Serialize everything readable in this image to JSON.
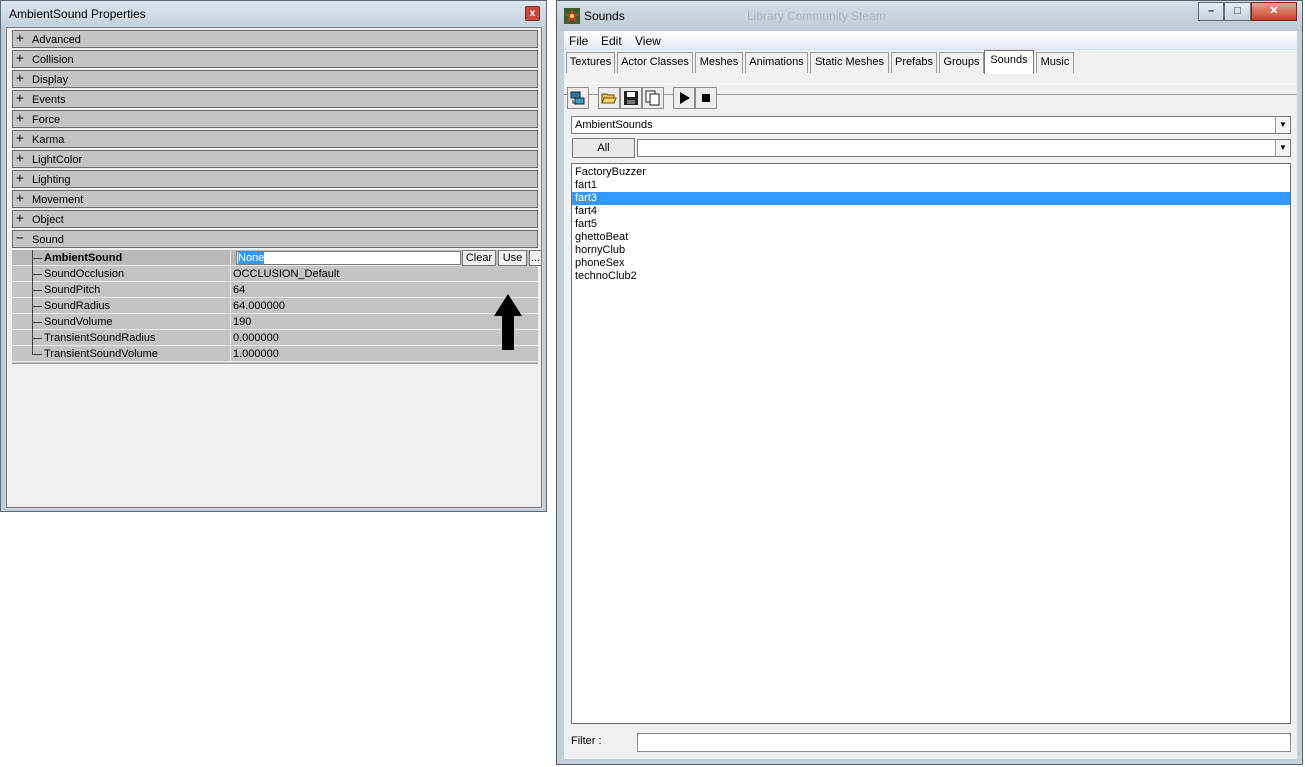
{
  "properties_window": {
    "title": "AmbientSound Properties",
    "close_glyph": "x",
    "categories": [
      {
        "label": "Advanced",
        "state": "+"
      },
      {
        "label": "Collision",
        "state": "+"
      },
      {
        "label": "Display",
        "state": "+"
      },
      {
        "label": "Events",
        "state": "+"
      },
      {
        "label": "Force",
        "state": "+"
      },
      {
        "label": "Karma",
        "state": "+"
      },
      {
        "label": "LightColor",
        "state": "+"
      },
      {
        "label": "Lighting",
        "state": "+"
      },
      {
        "label": "Movement",
        "state": "+"
      },
      {
        "label": "Object",
        "state": "+"
      },
      {
        "label": "Sound",
        "state": "−"
      }
    ],
    "sound_properties": [
      {
        "name": "AmbientSound",
        "value": "None"
      },
      {
        "name": "SoundOcclusion",
        "value": "OCCLUSION_Default"
      },
      {
        "name": "SoundPitch",
        "value": "64"
      },
      {
        "name": "SoundRadius",
        "value": "64.000000"
      },
      {
        "name": "SoundVolume",
        "value": "190"
      },
      {
        "name": "TransientSoundRadius",
        "value": "0.000000"
      },
      {
        "name": "TransientSoundVolume",
        "value": "1.000000"
      }
    ],
    "buttons": {
      "clear": "Clear",
      "use": "Use",
      "browse": "..."
    }
  },
  "sounds_window": {
    "title": "Sounds",
    "background_title": "Library  Community  Steam",
    "caption_buttons": {
      "minimize": "–",
      "maximize": "□",
      "close": "✕"
    },
    "menu": [
      "File",
      "Edit",
      "View"
    ],
    "tabs": [
      "Textures",
      "Actor Classes",
      "Meshes",
      "Animations",
      "Static Meshes",
      "Prefabs",
      "Groups",
      "Sounds",
      "Music"
    ],
    "active_tab": "Sounds",
    "toolbar_icons": [
      "import-icon",
      "open-icon",
      "save-icon",
      "copy-icon",
      "play-icon",
      "stop-icon"
    ],
    "package": "AmbientSounds",
    "all_button": "All",
    "group": "",
    "sounds": [
      "FactoryBuzzer",
      "fart1",
      "fart3",
      "fart4",
      "fart5",
      "ghettoBeat",
      "hornyClub",
      "phoneSex",
      "technoClub2"
    ],
    "selected_sound": "fart3",
    "filter_label": "Filter :",
    "filter_value": ""
  },
  "colors": {
    "selection": "#3399ff",
    "category_bg": "#c4c4c4",
    "close_red": "#c9493a"
  }
}
